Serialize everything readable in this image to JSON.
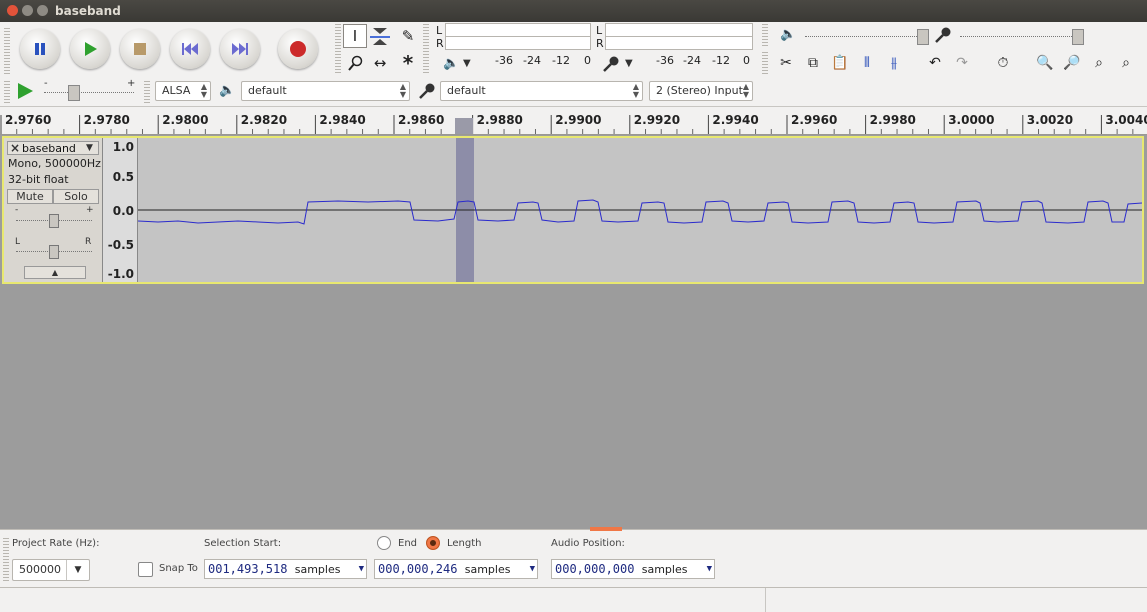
{
  "window": {
    "title": "baseband"
  },
  "meters": {
    "left_label": "L",
    "right_label": "R",
    "playback_ticks": [
      "-36",
      "-24",
      "-12",
      "0"
    ],
    "record_ticks": [
      "-36",
      "-24",
      "-12",
      "0"
    ]
  },
  "device": {
    "host": "ALSA",
    "output": "default",
    "input": "default",
    "channels": "2 (Stereo) Input"
  },
  "ruler": {
    "labels": [
      "2.9760",
      "2.9780",
      "2.9800",
      "2.9820",
      "2.9840",
      "2.9860",
      "2.9880",
      "2.9900",
      "2.9920",
      "2.9940",
      "2.9960",
      "2.9980",
      "3.0000",
      "3.0020",
      "3.0040"
    ]
  },
  "track": {
    "name": "baseband",
    "info_rate": "Mono, 500000Hz",
    "info_format": "32-bit float",
    "mute_label": "Mute",
    "solo_label": "Solo",
    "gain_minus": "-",
    "gain_plus": "+",
    "pan_left": "L",
    "pan_right": "R",
    "vruler": [
      "1.0",
      "0.5",
      "0.0",
      "-0.5",
      "-1.0"
    ]
  },
  "selection": {
    "project_rate_label": "Project Rate (Hz):",
    "project_rate": "500000",
    "snap_label": "Snap To",
    "selection_start_label": "Selection Start:",
    "end_label": "End",
    "length_label": "Length",
    "audio_position_label": "Audio Position:",
    "start_value": "001,493,518",
    "length_value": "000,000,246",
    "position_value": "000,000,000",
    "unit": "samples"
  },
  "colors": {
    "waveform": "#2b2bcc",
    "selection": "#8d8da8",
    "track_border": "#e8e870",
    "record": "#cc2a2a"
  }
}
